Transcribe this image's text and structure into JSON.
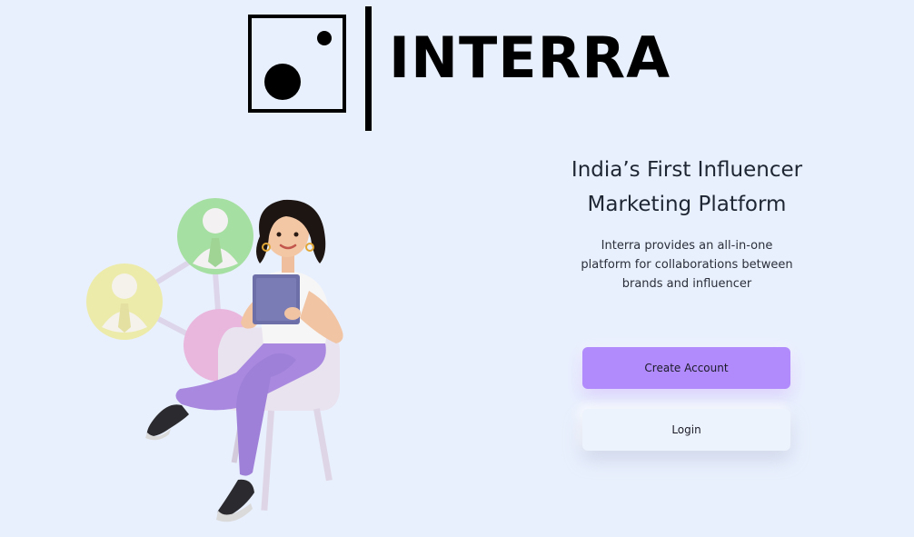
{
  "brand": {
    "name": "INTERRA"
  },
  "hero": {
    "title_line1": "India’s First Influencer",
    "title_line2": "Marketing Platform",
    "desc_line1": "Interra provides an all-in-one",
    "desc_line2": "platform for collaborations between",
    "desc_line3": "brands and influencer"
  },
  "actions": {
    "create_account": "Create Account",
    "login": "Login"
  },
  "illustration": {
    "icon": "woman-with-tablet-network-illustration",
    "colors": {
      "green_bubble": "#a6dfa2",
      "yellow_bubble": "#ecebaa",
      "pink_bubble": "#e9b6dd",
      "pants": "#a889df",
      "shirt": "#f6f6f6",
      "tablet": "#6d6fa9",
      "chair": "#e9e2ef"
    }
  },
  "colors": {
    "background": "#e9f0fd",
    "primary_button": "#b18bfb",
    "secondary_button": "#edf3fc",
    "text": "#1e2533"
  }
}
